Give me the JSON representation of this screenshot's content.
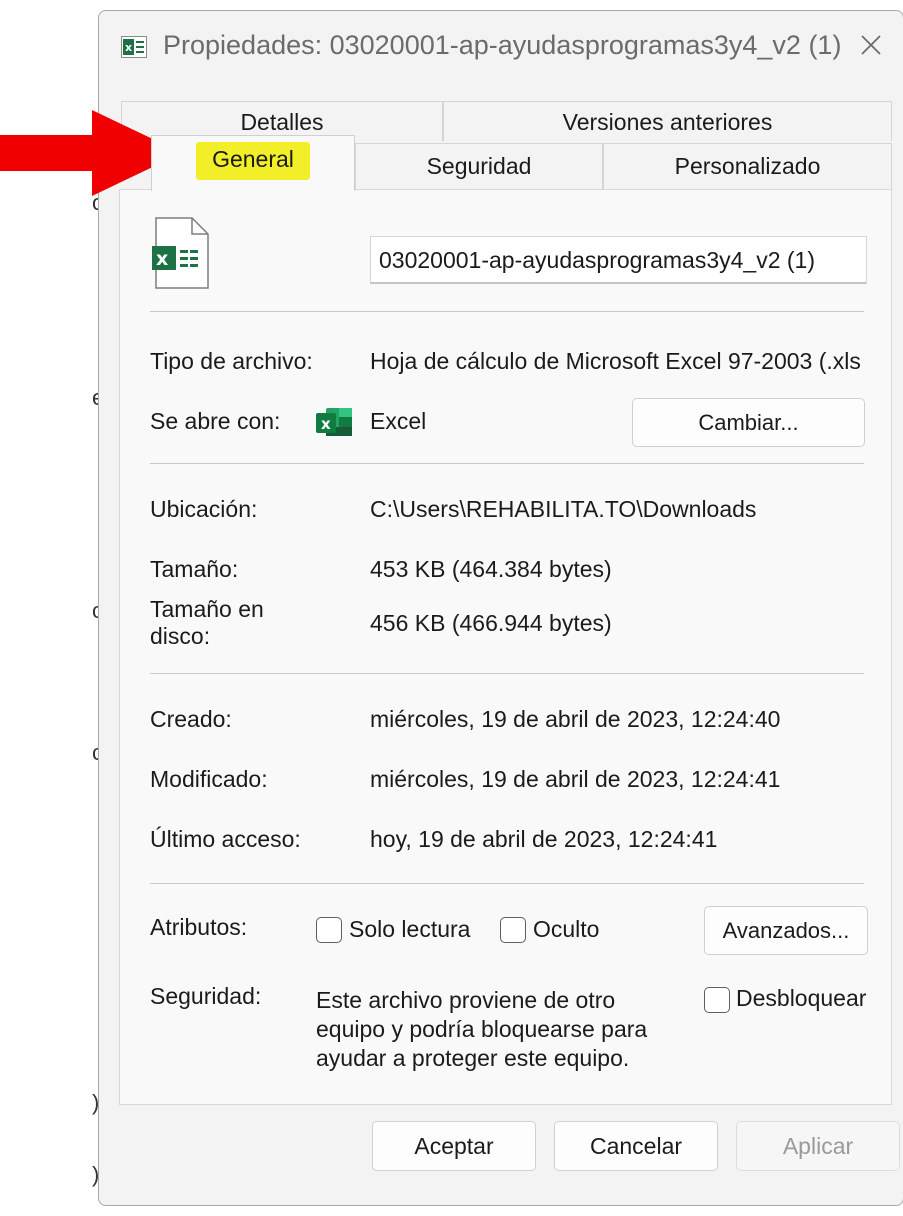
{
  "window": {
    "title": "Propiedades: 03020001-ap-ayudasprogramas3y4_v2 (1)",
    "close_glyph": "✕"
  },
  "tabs": {
    "row1": [
      {
        "label": "Detalles"
      },
      {
        "label": "Versiones anteriores"
      }
    ],
    "row2": [
      {
        "label": "General",
        "active": true
      },
      {
        "label": "Seguridad"
      },
      {
        "label": "Personalizado"
      }
    ]
  },
  "general": {
    "file_icon": "excel-file-icon",
    "filename": "03020001-ap-ayudasprogramas3y4_v2 (1)",
    "file_type_label": "Tipo de archivo:",
    "file_type_value": "Hoja de cálculo de Microsoft Excel 97-2003 (.xls",
    "opens_with_label": "Se abre con:",
    "opens_with_app": "Excel",
    "opens_with_icon": "excel-app-icon",
    "change_button": "Cambiar...",
    "location_label": "Ubicación:",
    "location_value": "C:\\Users\\REHABILITA.TO\\Downloads",
    "size_label": "Tamaño:",
    "size_value": "453 KB (464.384 bytes)",
    "size_on_disk_label_1": "Tamaño en",
    "size_on_disk_label_2": "disco:",
    "size_on_disk_value": "456 KB (466.944 bytes)",
    "created_label": "Creado:",
    "created_value": "miércoles, 19 de abril de 2023, 12:24:40",
    "modified_label": "Modificado:",
    "modified_value": "miércoles, 19 de abril de 2023, 12:24:41",
    "accessed_label": "Último acceso:",
    "accessed_value": "hoy, 19 de abril de 2023, 12:24:41",
    "attributes_label": "Atributos:",
    "readonly_label": "Solo lectura",
    "readonly_checked": false,
    "hidden_label": "Oculto",
    "hidden_checked": false,
    "advanced_button": "Avanzados...",
    "security_label": "Seguridad:",
    "security_text": "Este archivo proviene de otro equipo y podría bloquearse para ayudar a proteger este equipo.",
    "unblock_label": "Desbloquear",
    "unblock_checked": false
  },
  "footer": {
    "ok": "Aceptar",
    "cancel": "Cancelar",
    "apply": "Aplicar",
    "apply_enabled": false
  },
  "annotation": {
    "arrow_color": "#f00000",
    "highlight_color": "#f2ee27"
  },
  "background_fragments": [
    "o",
    "e",
    "c",
    "c",
    ")",
    ")"
  ]
}
